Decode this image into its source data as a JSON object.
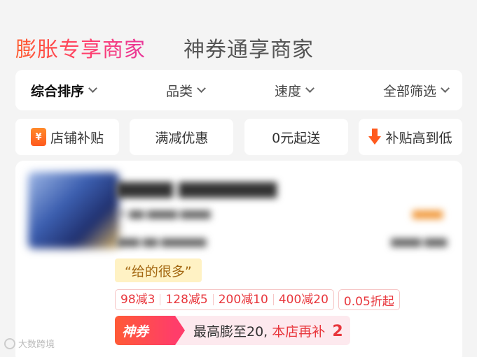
{
  "tabs": [
    {
      "label": "膨胀专享商家",
      "active": true
    },
    {
      "label": "神券通享商家",
      "active": false
    }
  ],
  "sort_bar": [
    {
      "label": "综合排序"
    },
    {
      "label": "品类"
    },
    {
      "label": "速度"
    },
    {
      "label": "全部筛选"
    }
  ],
  "filters": [
    {
      "label": "店铺补贴",
      "icon": "yen-icon"
    },
    {
      "label": "满减优惠"
    },
    {
      "label": "0元起送"
    },
    {
      "label": "补贴高到低",
      "icon": "down-arrow-icon"
    }
  ],
  "card": {
    "quote": "“给的很多”",
    "promos": [
      "98减3",
      "128减5",
      "200减10",
      "400减20"
    ],
    "discount": "0.05折起",
    "coupon": {
      "tag": "神券",
      "text_main": "最高膨至20,",
      "text_accent": "本店再补",
      "number": "2"
    }
  },
  "watermark": "大数跨境",
  "colors": {
    "accent": "#ff4a3c",
    "promo_red": "#e8363c",
    "quote_bg": "#fff2c4"
  }
}
